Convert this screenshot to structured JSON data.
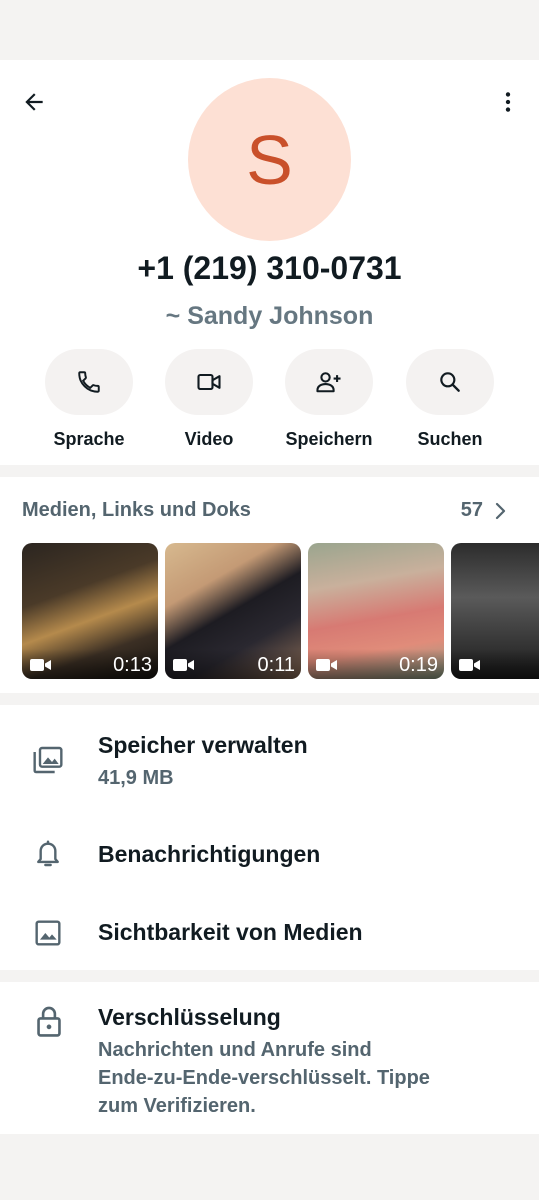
{
  "contact": {
    "avatar_letter": "S",
    "phone": "+1 (219) 310-0731",
    "subname": "~ Sandy Johnson"
  },
  "icons": {
    "back": "arrow-left-icon",
    "menu": "more-vert-icon",
    "voice": "phone-icon",
    "video": "videocam-icon",
    "save": "person-add-icon",
    "search": "search-icon",
    "storage": "photo-library-icon",
    "notifications": "bell-icon",
    "media_visibility": "image-icon",
    "encryption": "lock-icon"
  },
  "actions": [
    {
      "label": "Sprache"
    },
    {
      "label": "Video"
    },
    {
      "label": "Speichern"
    },
    {
      "label": "Suchen"
    }
  ],
  "media": {
    "title": "Medien, Links und Doks",
    "count": "57",
    "items": [
      {
        "duration": "0:13"
      },
      {
        "duration": "0:11"
      },
      {
        "duration": "0:19"
      },
      {
        "duration": ""
      }
    ]
  },
  "settings": {
    "storage_title": "Speicher verwalten",
    "storage_size": "41,9 MB",
    "notifications_title": "Benachrichtigungen",
    "media_visibility_title": "Sichtbarkeit von Medien"
  },
  "encryption": {
    "title": "Verschlüsselung",
    "line1": "Nachrichten und Anrufe sind",
    "line2": "Ende-zu-Ende-verschlüsselt. Tippe",
    "line3": "zum Verifizieren."
  },
  "colors": {
    "avatar_bg": "#fde0d4",
    "avatar_letter": "#c9502a",
    "secondary_text": "#54656f",
    "action_bg": "#f4f2f1"
  }
}
